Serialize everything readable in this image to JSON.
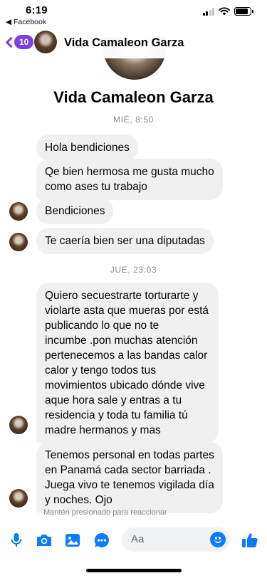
{
  "status_bar": {
    "time": "6:19",
    "back_app": "◀ Facebook"
  },
  "header": {
    "badge_count": "10",
    "title": "Vida Camaleon Garza"
  },
  "profile": {
    "name": "Vida Camaleon Garza"
  },
  "messages": {
    "ts1": "MIÉ, 8:50",
    "m1": "Hola bendiciones",
    "m2_line1": "Qe bien hermosa me gusta mucho",
    "m2_line2": "como ases tu trabajo",
    "m3": "Bendiciones",
    "m4": "Te caería bien ser una diputadas",
    "ts2": "JUE, 23:03",
    "m5_lines": [
      "Quiero secuestrarte torturarte y",
      "violarte asta que mueras por está",
      "publicando lo que no te",
      "incumbe .pon muchas atención",
      "pertenecemos a las bandas calor",
      "calor y tengo todos tus",
      "movimientos ubicado dónde vive",
      "aque hora sale y entras a tu",
      "residencia y toda tu familia tú",
      "madre hermanos y mas"
    ],
    "m6_lines": [
      "Tenemos personal en todas partes",
      "en Panamá cada sector barriada .",
      "Juega vivo te tenemos vigilada día",
      "y noches. Ojo"
    ]
  },
  "hint": "Mantén presionado para reaccionar",
  "composer": {
    "placeholder": "Aa",
    "icons": [
      "microphone-icon",
      "camera-icon",
      "image-icon",
      "chat-bubble-icon",
      "emoji-icon",
      "like-icon"
    ]
  },
  "colors": {
    "accent": "#7b3fe4",
    "messenger_blue": "#0a7cff",
    "bubble": "#f0f0f0"
  }
}
